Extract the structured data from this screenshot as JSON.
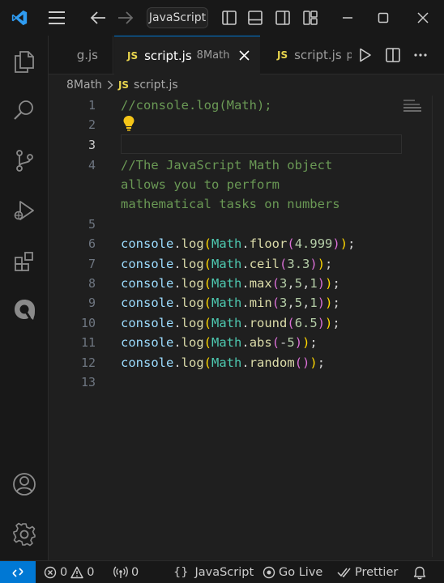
{
  "titlebar": {
    "search_text": "JavaScript",
    "icons": [
      "vscode-logo-icon",
      "menu-icon",
      "back-arrow-icon",
      "forward-arrow-icon",
      "toggle-primary-sidebar-icon",
      "toggle-panel-icon",
      "toggle-secondary-sidebar-icon",
      "customize-layout-icon",
      "minimize-icon",
      "maximize-icon",
      "close-icon"
    ]
  },
  "activity_bar": {
    "icons": [
      "explorer-icon",
      "search-icon",
      "source-control-icon",
      "run-debug-icon",
      "extensions-icon",
      "quokka-icon",
      "accounts-icon",
      "manage-gear-icon"
    ]
  },
  "tabs": [
    {
      "label": "g.js",
      "description": "",
      "active": false
    },
    {
      "label": "script.js",
      "description": "8Math",
      "active": true
    },
    {
      "label": "script.js",
      "description": "p",
      "active": false
    }
  ],
  "tab_actions": [
    "run-icon",
    "split-editor-icon",
    "more-actions-icon"
  ],
  "breadcrumb": {
    "folder": "8Math",
    "file": "script.js"
  },
  "editor": {
    "current_line": 3,
    "line_numbers": [
      "1",
      "2",
      "3",
      "4",
      "",
      "",
      "5",
      "6",
      "7",
      "8",
      "9",
      "10",
      "11",
      "12",
      "13"
    ],
    "comment1": "//console.log(Math);",
    "comment2_lines": [
      "//The JavaScript Math object",
      "allows you to perform",
      "mathematical tasks on numbers"
    ],
    "t_console": "console",
    "t_dot": ".",
    "t_log": "log",
    "t_math": "Math",
    "t_open": "(",
    "t_close": ")",
    "t_semi": ";",
    "t_comma": ",",
    "t_minus": "-",
    "calls": {
      "floor": {
        "method": "floor",
        "args": [
          "4.999"
        ]
      },
      "ceil": {
        "method": "ceil",
        "args": [
          "3.3"
        ]
      },
      "max": {
        "method": "max",
        "args": [
          "3",
          "5",
          "1"
        ]
      },
      "min": {
        "method": "min",
        "args": [
          "3",
          "5",
          "1"
        ]
      },
      "round": {
        "method": "round",
        "args": [
          "6.5"
        ]
      },
      "abs": {
        "method": "abs",
        "args": [
          "5"
        ]
      },
      "random": {
        "method": "random",
        "args": []
      }
    }
  },
  "status_bar": {
    "errors": "0",
    "warnings": "0",
    "ports": "0",
    "language": "JavaScript",
    "language_prefix": "{}",
    "go_live": "Go Live",
    "prettier": "Prettier"
  },
  "colors": {
    "accent": "#0078d4",
    "background": "#1f1f1f",
    "comment": "#6a9955",
    "variable": "#9cdcfe",
    "class": "#4ec9b0",
    "function": "#dcdcaa",
    "number": "#b5cea8",
    "bracket_level1": "#ffd700",
    "bracket_level2": "#da70d6",
    "bracket_level3": "#179fff"
  }
}
